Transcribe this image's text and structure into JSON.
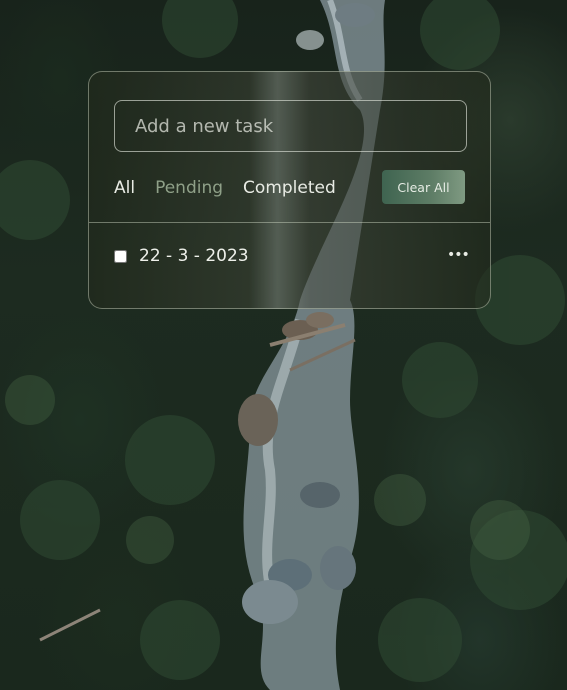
{
  "todo": {
    "input": {
      "placeholder": "Add a new task",
      "value": ""
    },
    "filters": [
      {
        "label": "All",
        "active": true
      },
      {
        "label": "Pending",
        "active": false
      },
      {
        "label": "Completed",
        "active": false
      }
    ],
    "clear_all_label": "Clear All",
    "tasks": [
      {
        "text": "22 - 3 - 2023",
        "done": false,
        "menu_icon": "ellipsis-icon"
      }
    ]
  },
  "colors": {
    "accent_button": "#5e7d66",
    "pending_filter": "#8fa088",
    "text": "#e8ebe4"
  }
}
